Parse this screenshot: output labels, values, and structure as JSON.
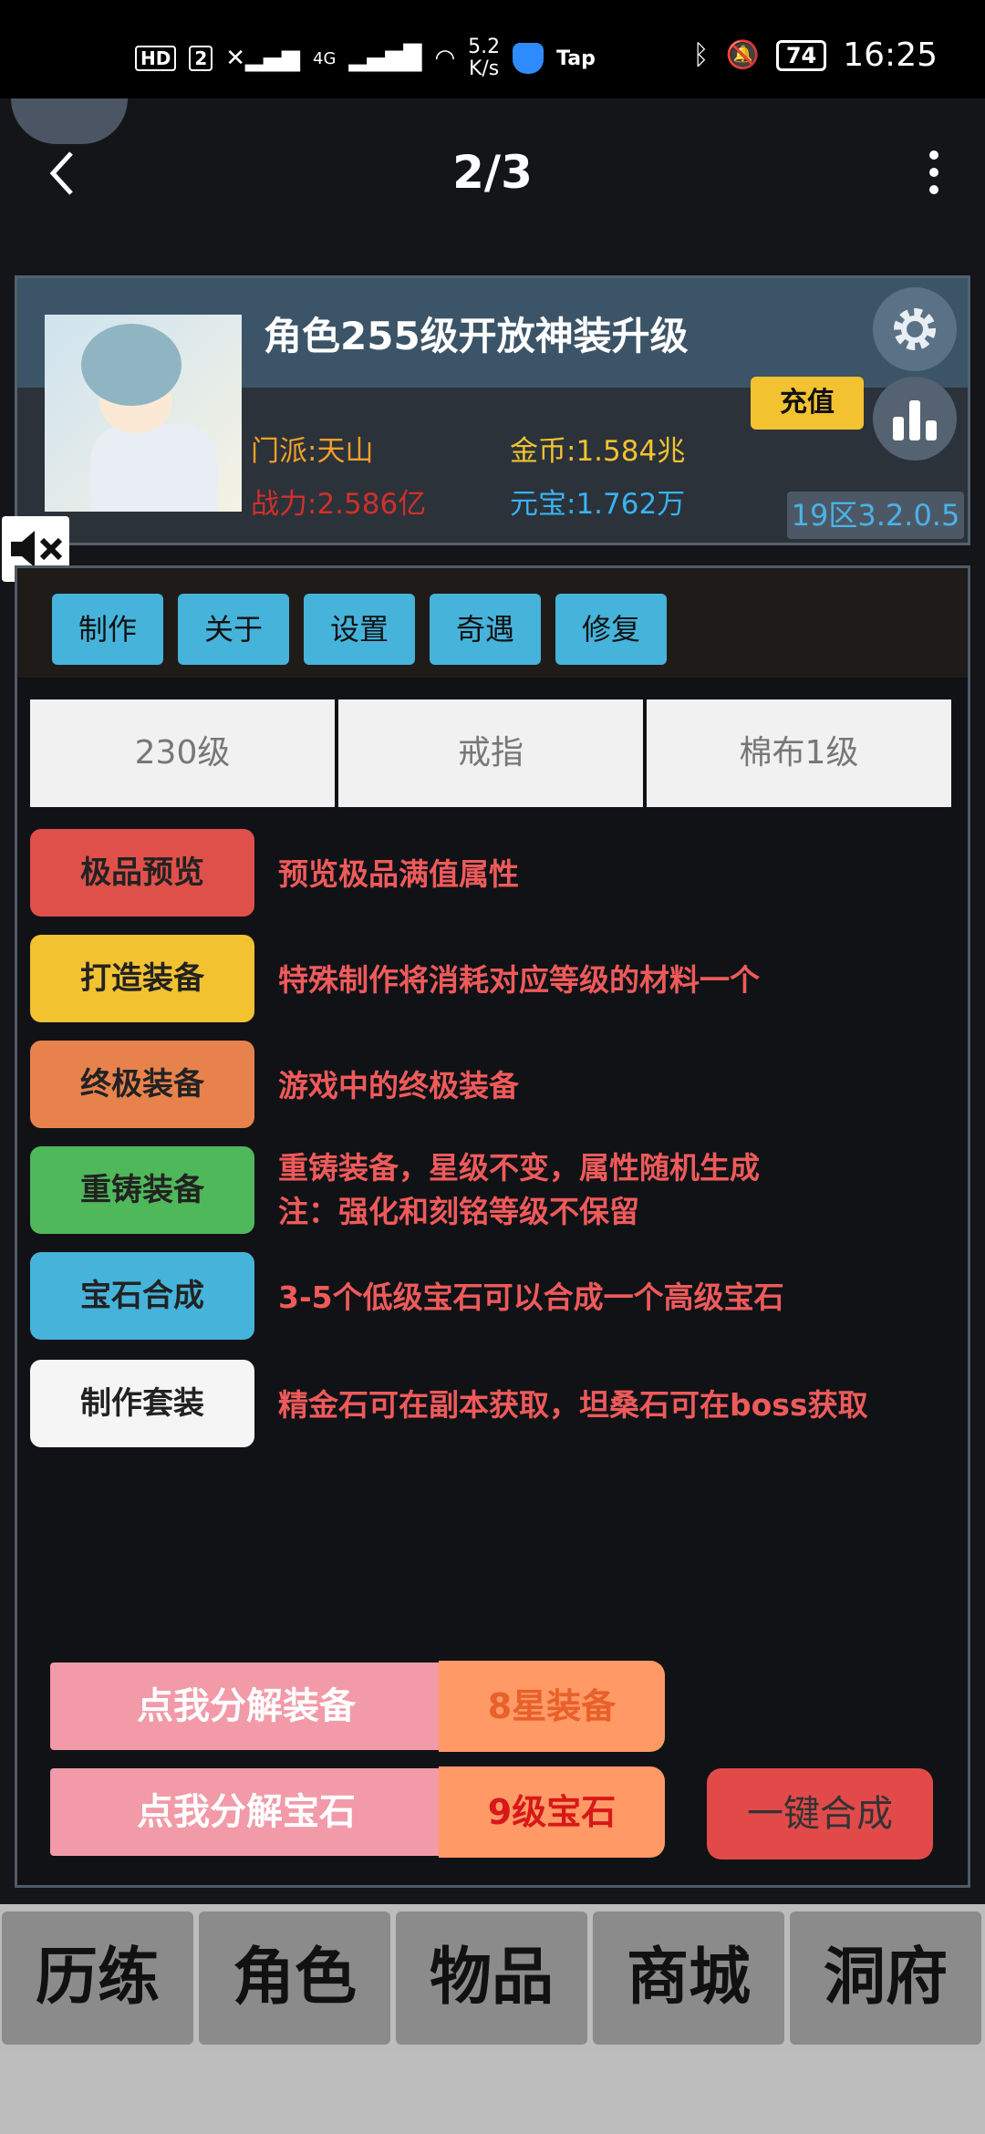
{
  "status_bar": {
    "hd": "HD",
    "sim": "2",
    "network": "4G",
    "speed_value": "5.2",
    "speed_unit": "K/s",
    "tap_label": "Tap",
    "battery": "74",
    "time": "16:25"
  },
  "nav": {
    "title": "2/3"
  },
  "character": {
    "title": "角色255级开放神装升级",
    "sect": "门派:天山",
    "power": "战力:2.586亿",
    "gold": "金币:1.584兆",
    "ingot": "元宝:1.762万",
    "recharge_label": "充值",
    "version": "19区3.2.0.5"
  },
  "tabs": [
    "制作",
    "关于",
    "设置",
    "奇遇",
    "修复"
  ],
  "selectors": [
    "230级",
    "戒指",
    "棉布1级"
  ],
  "actions": [
    {
      "label": "极品预览",
      "color": "#e0504a",
      "desc1": "预览极品满值属性",
      "desc2": ""
    },
    {
      "label": "打造装备",
      "color": "#f2c230",
      "desc1": "特殊制作将消耗对应等级的材料一个",
      "desc2": ""
    },
    {
      "label": "终极装备",
      "color": "#e8824d",
      "desc1": "游戏中的终极装备",
      "desc2": ""
    },
    {
      "label": "重铸装备",
      "color": "#4fb85a",
      "desc1": "重铸装备，星级不变，属性随机生成",
      "desc2": "注：强化和刻铭等级不保留"
    },
    {
      "label": "宝石合成",
      "color": "#46b3db",
      "desc1": "3-5个低级宝石可以合成一个高级宝石",
      "desc2": ""
    },
    {
      "label": "制作套装",
      "color": "#f5f5f5",
      "desc1": "精金石可在副本获取，坦桑石可在boss获取",
      "desc2": ""
    }
  ],
  "decompose": {
    "equip_label": "点我分解装备",
    "equip_value": "8星装备",
    "gem_label": "点我分解宝石",
    "gem_value": "9级宝石",
    "one_click": "一键合成"
  },
  "bottom_nav": [
    "历练",
    "角色",
    "物品",
    "商城",
    "洞府"
  ]
}
